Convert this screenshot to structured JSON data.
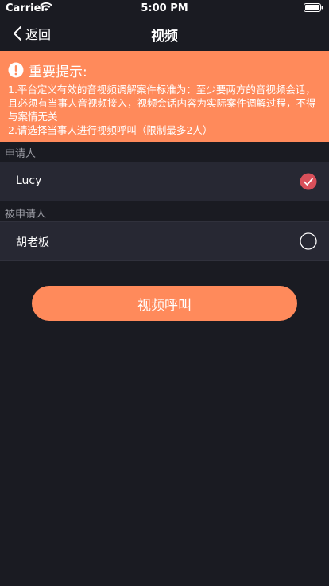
{
  "status": {
    "carrier": "Carrier",
    "time": "5:00 PM"
  },
  "nav": {
    "back_label": "返回",
    "title": "视频"
  },
  "notice": {
    "title": "重要提示:",
    "line1": "1.平台定义有效的音视频调解案件标准为：至少要两方的音视频会话，且必须有当事人音视频接入，视频会话内容为实际案件调解过程，不得与案情无关",
    "line2": "2.请选择当事人进行视频呼叫（限制最多2人）"
  },
  "applicants": {
    "label": "申请人",
    "items": [
      {
        "name": "Lucy",
        "selected": true
      }
    ]
  },
  "respondents": {
    "label": "被申请人",
    "items": [
      {
        "name": "胡老板",
        "selected": false
      }
    ]
  },
  "call_button": {
    "label": "视频呼叫"
  },
  "colors": {
    "background": "#1a1b22",
    "row": "#272833",
    "accent": "#ff8a5b",
    "check_selected": "#d9505a"
  },
  "icons": [
    "wifi-icon",
    "battery-icon",
    "chevron-left-icon",
    "alert-icon",
    "checkmark-circle-icon",
    "empty-circle-icon"
  ]
}
